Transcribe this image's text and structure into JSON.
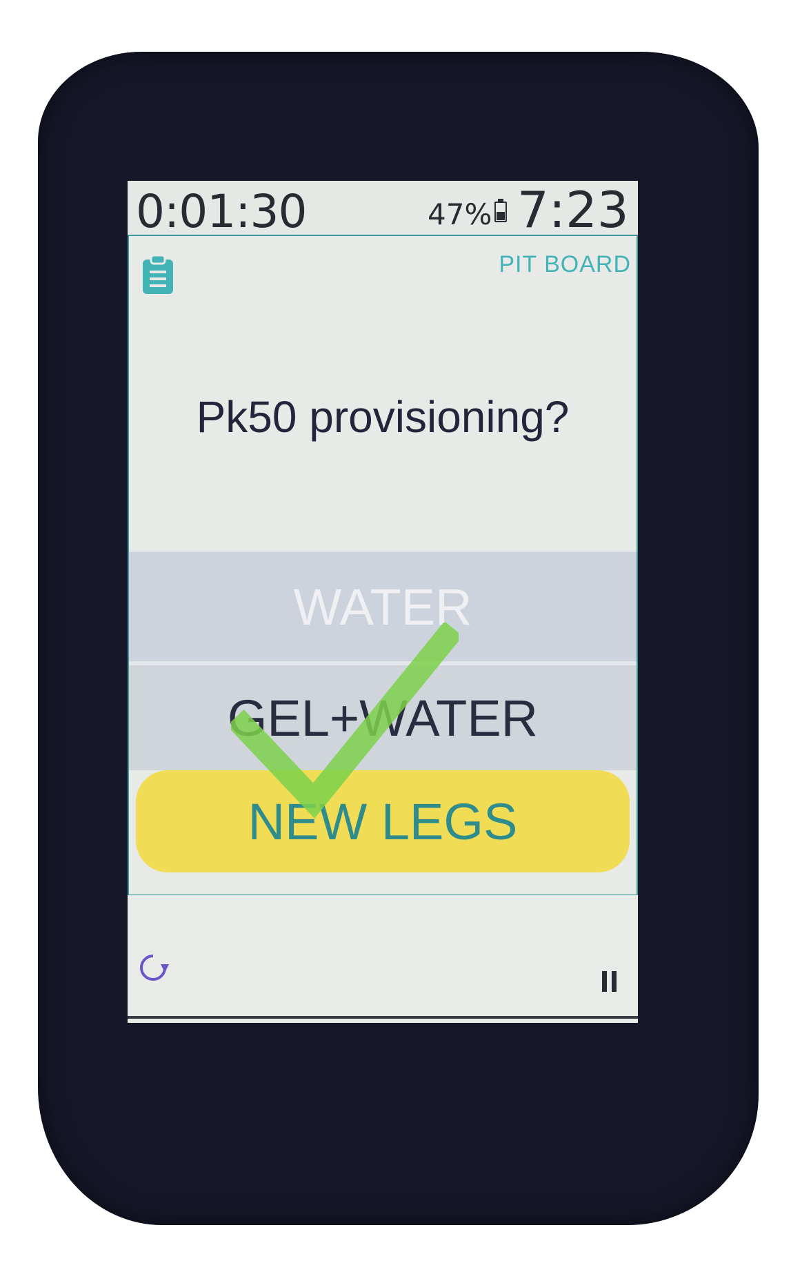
{
  "status": {
    "elapsed_time": "0:01:30",
    "battery_percent": "47%",
    "battery_level": 0.47,
    "clock": "7:23"
  },
  "panel": {
    "icon": "clipboard-icon",
    "title": "PIT BOARD",
    "question": "Pk50 provisioning?"
  },
  "options": [
    {
      "label": "WATER",
      "state": "faded"
    },
    {
      "label": "GEL+WATER",
      "state": "normal"
    },
    {
      "label": "NEW LEGS",
      "state": "selected"
    }
  ],
  "overlay": {
    "icon": "checkmark-icon",
    "color": "#7cd14b"
  },
  "controls": {
    "refresh_icon": "refresh-icon",
    "pause_icon": "pause-icon"
  },
  "colors": {
    "accent": "#42b4b6",
    "selected_bg": "#f0dc55",
    "selected_text": "#2f8c8c",
    "text": "#24253a"
  }
}
